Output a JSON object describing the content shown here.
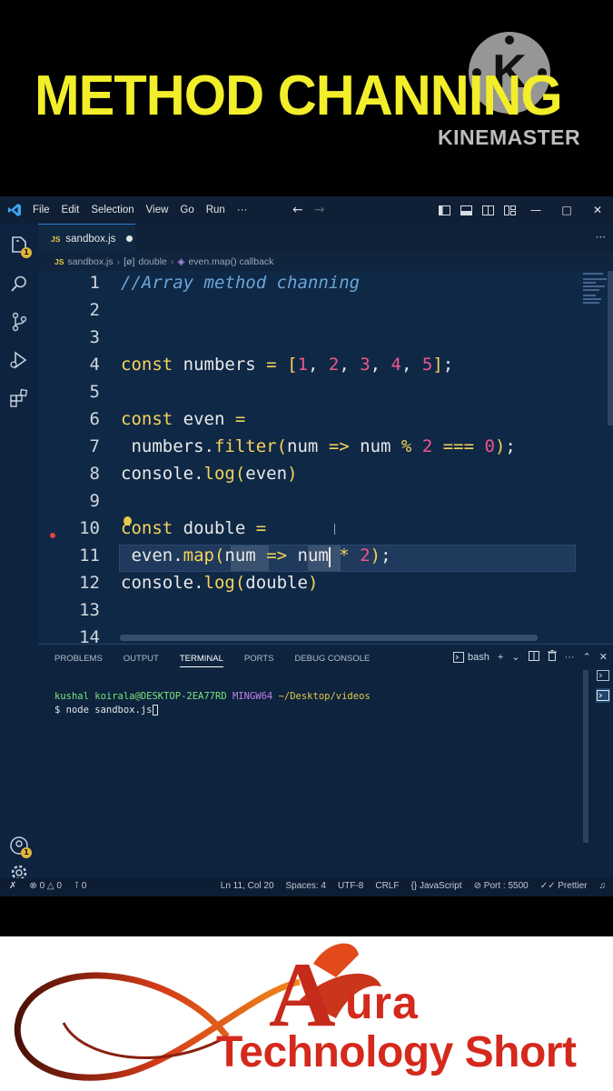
{
  "banner": {
    "title": "METHOD CHANNING",
    "watermark_text": "KINEMASTER",
    "title_color": "#f2ee2a"
  },
  "titlebar": {
    "menu": [
      "File",
      "Edit",
      "Selection",
      "View",
      "Go",
      "Run",
      "···"
    ],
    "icons": [
      "vscode-logo-icon",
      "back-arrow-icon",
      "forward-arrow-icon",
      "toggle-sidebar-icon",
      "toggle-panel-icon",
      "toggle-secondary-sidebar-icon",
      "customize-layout-icon",
      "minimize-icon",
      "maximize-icon",
      "close-icon"
    ]
  },
  "activity_bar": {
    "items": [
      "explorer-icon",
      "search-icon",
      "source-control-icon",
      "run-debug-icon",
      "extensions-icon"
    ],
    "bottom_items": [
      "accounts-icon",
      "manage-gear-icon"
    ],
    "explorer_badge": "1",
    "accounts_badge": "1"
  },
  "tab": {
    "icon": "JS",
    "label": "sandbox.js",
    "more": "···"
  },
  "breadcrumb": {
    "file_icon": "JS",
    "file": "sandbox.js",
    "symbol_icon": "[ø]",
    "symbol": "double",
    "method_icon": "◈",
    "method": "even.map() callback"
  },
  "editor": {
    "line_numbers": [
      "1",
      "2",
      "3",
      "4",
      "5",
      "6",
      "7",
      "8",
      "9",
      "10",
      "11",
      "12",
      "13",
      "14"
    ],
    "current_line": 11,
    "lines": {
      "l1": "//Array method channing",
      "l4": [
        "const",
        " numbers ",
        "=",
        " ",
        "[",
        "1",
        ", ",
        "2",
        ", ",
        "3",
        ", ",
        "4",
        ", ",
        "5",
        "]",
        ";"
      ],
      "l6": [
        "const",
        " even ",
        "="
      ],
      "l7": [
        " numbers.",
        "filter",
        "(",
        "num ",
        "=>",
        " num ",
        "%",
        " ",
        "2",
        " ",
        "===",
        " ",
        "0",
        ")",
        ";"
      ],
      "l8": [
        "console.",
        "log",
        "(",
        "even",
        ")"
      ],
      "l10": [
        "const",
        " double ",
        "="
      ],
      "l11": [
        " even.",
        "map",
        "(",
        "num ",
        "=>",
        " num ",
        "*",
        " ",
        "2",
        ")",
        ";"
      ],
      "l12": [
        "console.",
        "log",
        "(",
        "double",
        ")"
      ]
    }
  },
  "panel": {
    "tabs": [
      "PROBLEMS",
      "OUTPUT",
      "TERMINAL",
      "PORTS",
      "DEBUG CONSOLE"
    ],
    "active_tab": "TERMINAL",
    "shell": "bash",
    "terminal": {
      "user": "kushal koirala@DESKTOP-2EA77RD",
      "env": "MINGW64",
      "path": "~/Desktop/videos",
      "prompt": "$",
      "command": "node sandbox.js"
    }
  },
  "statusbar": {
    "errors": "0",
    "warnings": "0",
    "ports_fwd": "0",
    "position": "Ln 11, Col 20",
    "spaces": "Spaces: 4",
    "encoding": "UTF-8",
    "eol": "CRLF",
    "language": "JavaScript",
    "port": "Port : 5500",
    "prettier": "Prettier"
  },
  "logo": {
    "aura_initial": "A",
    "aura_rest": "ura",
    "tagline": "Technology Short",
    "color": "#d4291c"
  }
}
